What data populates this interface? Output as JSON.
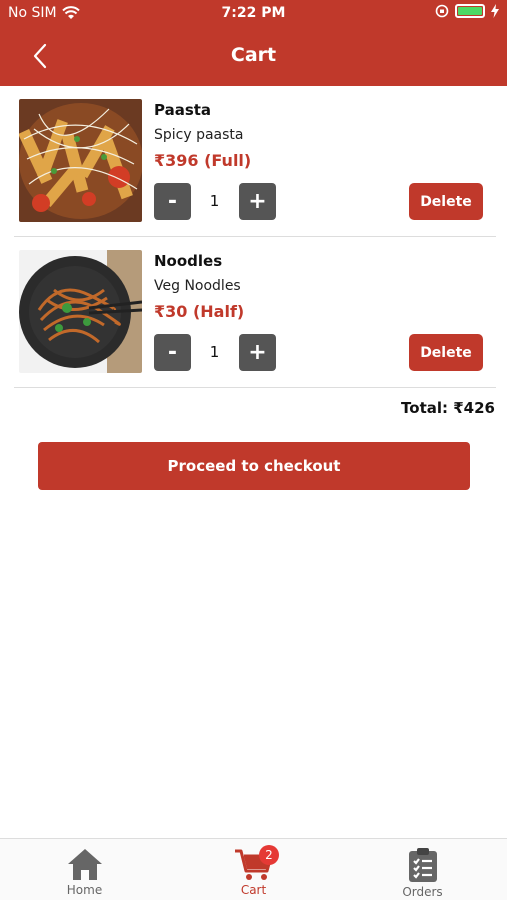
{
  "status": {
    "carrier": "No SIM",
    "time": "7:22 PM"
  },
  "nav": {
    "title": "Cart"
  },
  "items": [
    {
      "name": "Paasta",
      "description": "Spicy paasta",
      "price": "₹396 (Full)",
      "qty": "1",
      "minus": "-",
      "plus": "+",
      "delete": "Delete",
      "image_icon": "pasta-photo"
    },
    {
      "name": "Noodles",
      "description": "Veg Noodles",
      "price": "₹30 (Half)",
      "qty": "1",
      "minus": "-",
      "plus": "+",
      "delete": "Delete",
      "image_icon": "noodles-photo"
    }
  ],
  "total": "Total: ₹426",
  "checkout": "Proceed to checkout",
  "tabs": [
    {
      "label": "Home",
      "icon": "home-icon"
    },
    {
      "label": "Cart",
      "icon": "cart-icon",
      "badge": "2",
      "active": true
    },
    {
      "label": "Orders",
      "icon": "clipboard-icon"
    }
  ],
  "colors": {
    "primary": "#c0392b",
    "qty_button": "#555555",
    "badge": "#e53935"
  }
}
